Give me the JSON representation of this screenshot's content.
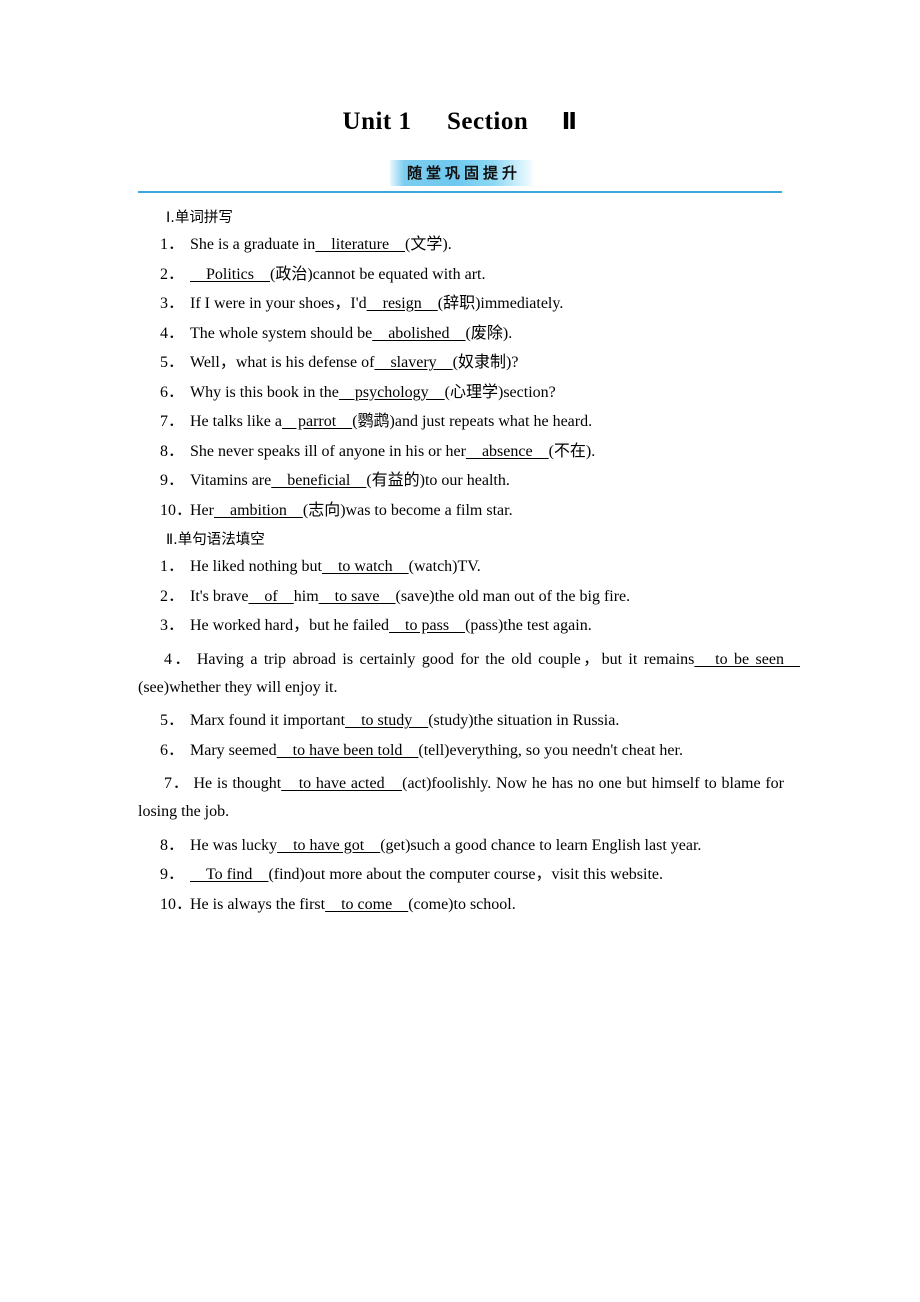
{
  "title": {
    "unit": "Unit 1",
    "section": "Section",
    "numeral": "Ⅱ"
  },
  "badge": {
    "label": "随堂巩固提升",
    "fill_color": "#7ccdef",
    "rule_color": "#3aa7dd"
  },
  "sections": [
    {
      "heading": "Ⅰ.单词拼写",
      "items": [
        {
          "num": "1．",
          "parts": [
            {
              "t": "She is a graduate in"
            },
            {
              "b": "　literature　"
            },
            {
              "t": "(文学)."
            }
          ]
        },
        {
          "num": "2．",
          "parts": [
            {
              "b": "　Politics　"
            },
            {
              "t": "(政治)cannot be equated with art."
            }
          ]
        },
        {
          "num": "3．",
          "parts": [
            {
              "t": "If I were in your shoes，I'd"
            },
            {
              "b": "　resign　"
            },
            {
              "t": "(辞职)immediately."
            }
          ]
        },
        {
          "num": "4．",
          "parts": [
            {
              "t": "The whole system should be"
            },
            {
              "b": "　abolished　"
            },
            {
              "t": "(废除)."
            }
          ]
        },
        {
          "num": "5．",
          "parts": [
            {
              "t": "Well，what is his defense of"
            },
            {
              "b": "　slavery　"
            },
            {
              "t": "(奴隶制)?"
            }
          ]
        },
        {
          "num": "6．",
          "parts": [
            {
              "t": "Why is this book in the"
            },
            {
              "b": "　psychology　"
            },
            {
              "t": "(心理学)section?"
            }
          ]
        },
        {
          "num": "7．",
          "parts": [
            {
              "t": "He talks like a"
            },
            {
              "b": "　parrot　"
            },
            {
              "t": "(鹦鹉)and just repeats what he heard."
            }
          ]
        },
        {
          "num": "8．",
          "parts": [
            {
              "t": "She never speaks ill of anyone in his or her"
            },
            {
              "b": "　absence　"
            },
            {
              "t": "(不在)."
            }
          ]
        },
        {
          "num": "9．",
          "parts": [
            {
              "t": "Vitamins are"
            },
            {
              "b": "　beneficial　"
            },
            {
              "t": "(有益的)to our health."
            }
          ]
        },
        {
          "num": "10．",
          "parts": [
            {
              "t": "Her"
            },
            {
              "b": "　ambition　"
            },
            {
              "t": "(志向)was to become a film star."
            }
          ]
        }
      ]
    },
    {
      "heading": "Ⅱ.单句语法填空",
      "items": [
        {
          "num": "1．",
          "parts": [
            {
              "t": "He liked nothing but"
            },
            {
              "b": "　to watch　"
            },
            {
              "t": "(watch)TV."
            }
          ]
        },
        {
          "num": "2．",
          "parts": [
            {
              "t": "It's brave"
            },
            {
              "b": "　of　"
            },
            {
              "t": "him"
            },
            {
              "b": "　to save　"
            },
            {
              "t": "(save)the old man out of the big fire."
            }
          ]
        },
        {
          "num": "3．",
          "parts": [
            {
              "t": "He worked hard，but he failed"
            },
            {
              "b": "　to pass　"
            },
            {
              "t": "(pass)the test again."
            }
          ]
        },
        {
          "num": "4．",
          "justified": true,
          "parts": [
            {
              "t": "Having a trip abroad is certainly good for the old couple，but it remains"
            },
            {
              "b": "　to be seen　"
            },
            {
              "t": "(see)whether they will enjoy it."
            }
          ]
        },
        {
          "num": "5．",
          "parts": [
            {
              "t": "Marx found it important"
            },
            {
              "b": "　to study　"
            },
            {
              "t": "(study)the situation in Russia."
            }
          ]
        },
        {
          "num": "6．",
          "parts": [
            {
              "t": "Mary seemed"
            },
            {
              "b": "　to have been told　"
            },
            {
              "t": "(tell)everything, so you needn't cheat her."
            }
          ]
        },
        {
          "num": "7．",
          "justified": true,
          "parts": [
            {
              "t": "He is thought"
            },
            {
              "b": "　to have acted　"
            },
            {
              "t": "(act)foolishly. Now he has no one but himself to blame for losing the job."
            }
          ]
        },
        {
          "num": "8．",
          "parts": [
            {
              "t": "He was lucky"
            },
            {
              "b": "　to have got　"
            },
            {
              "t": "(get)such a good chance to learn English last year."
            }
          ]
        },
        {
          "num": "9．",
          "parts": [
            {
              "b": "　To find　"
            },
            {
              "t": "(find)out more about the computer course，visit this website."
            }
          ]
        },
        {
          "num": "10．",
          "parts": [
            {
              "t": "He is always the first"
            },
            {
              "b": "　to come　"
            },
            {
              "t": "(come)to school."
            }
          ]
        }
      ]
    }
  ]
}
